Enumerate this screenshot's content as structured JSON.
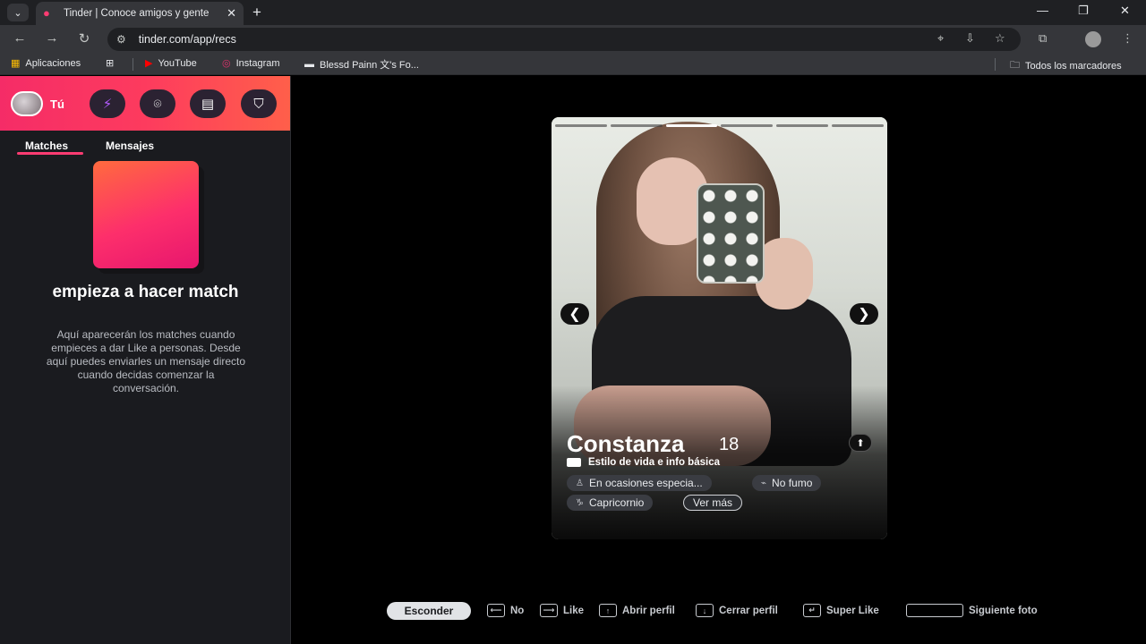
{
  "browser": {
    "tab_title": "Tinder | Conoce amigos y gente",
    "new_tab": "+",
    "url": "tinder.com/app/recs",
    "bookmarks": {
      "apps": "Aplicaciones",
      "youtube": "YouTube",
      "instagram": "Instagram",
      "blessd": "Blessd Painn 文's Fo...",
      "all": "Todos los marcadores"
    }
  },
  "sidebar": {
    "user_label": "Tú",
    "tabs": [
      "Matches",
      "Mensajes"
    ],
    "empty_title": "empieza a hacer match",
    "empty_desc": "Aquí aparecerán los matches cuando empieces a dar Like a personas. Desde aquí puedes enviarles un mensaje directo cuando decidas comenzar la conversación."
  },
  "profile": {
    "name": "Constanza",
    "age": "18",
    "section": "Estilo de vida e info básica",
    "chips": [
      "En ocasiones especia...",
      "No fumo",
      "Capricornio"
    ],
    "more": "Ver más",
    "photo_count": 6,
    "active_photo": 3
  },
  "hints": {
    "hide": "Esconder",
    "no": "No",
    "like": "Like",
    "open": "Abrir perfil",
    "close": "Cerrar perfil",
    "super": "Super Like",
    "next": "Siguiente foto"
  },
  "colors": {
    "brand": "#fe3c72",
    "accent_gradient_end": "#ff5f4a"
  }
}
